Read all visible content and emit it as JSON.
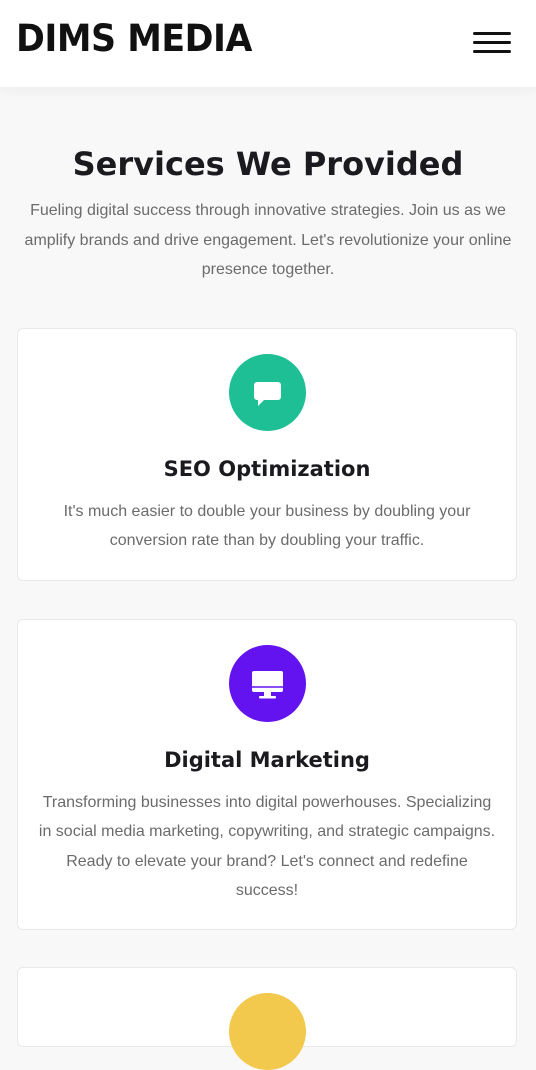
{
  "header": {
    "brand": "DIMS MEDIA",
    "menu_icon": "hamburger-menu-icon"
  },
  "services": {
    "title": "Services We Provided",
    "description": "Fueling digital success through innovative strategies. Join us as we amplify brands and drive engagement. Let's revolutionize your online presence together.",
    "items": [
      {
        "icon": "chat-bubble-icon",
        "icon_color": "#1fbf96",
        "title": "SEO Optimization",
        "description": "It's much easier to double your business by doubling your conversion rate than by doubling your traffic."
      },
      {
        "icon": "desktop-monitor-icon",
        "icon_color": "#6312f0",
        "title": "Digital Marketing",
        "description": "Transforming businesses into digital powerhouses. Specializing in social media marketing, copywriting, and strategic campaigns. Ready to elevate your brand? Let's connect and redefine success!"
      },
      {
        "icon": "partially-visible-icon",
        "icon_color": "#f2c94c"
      }
    ]
  }
}
